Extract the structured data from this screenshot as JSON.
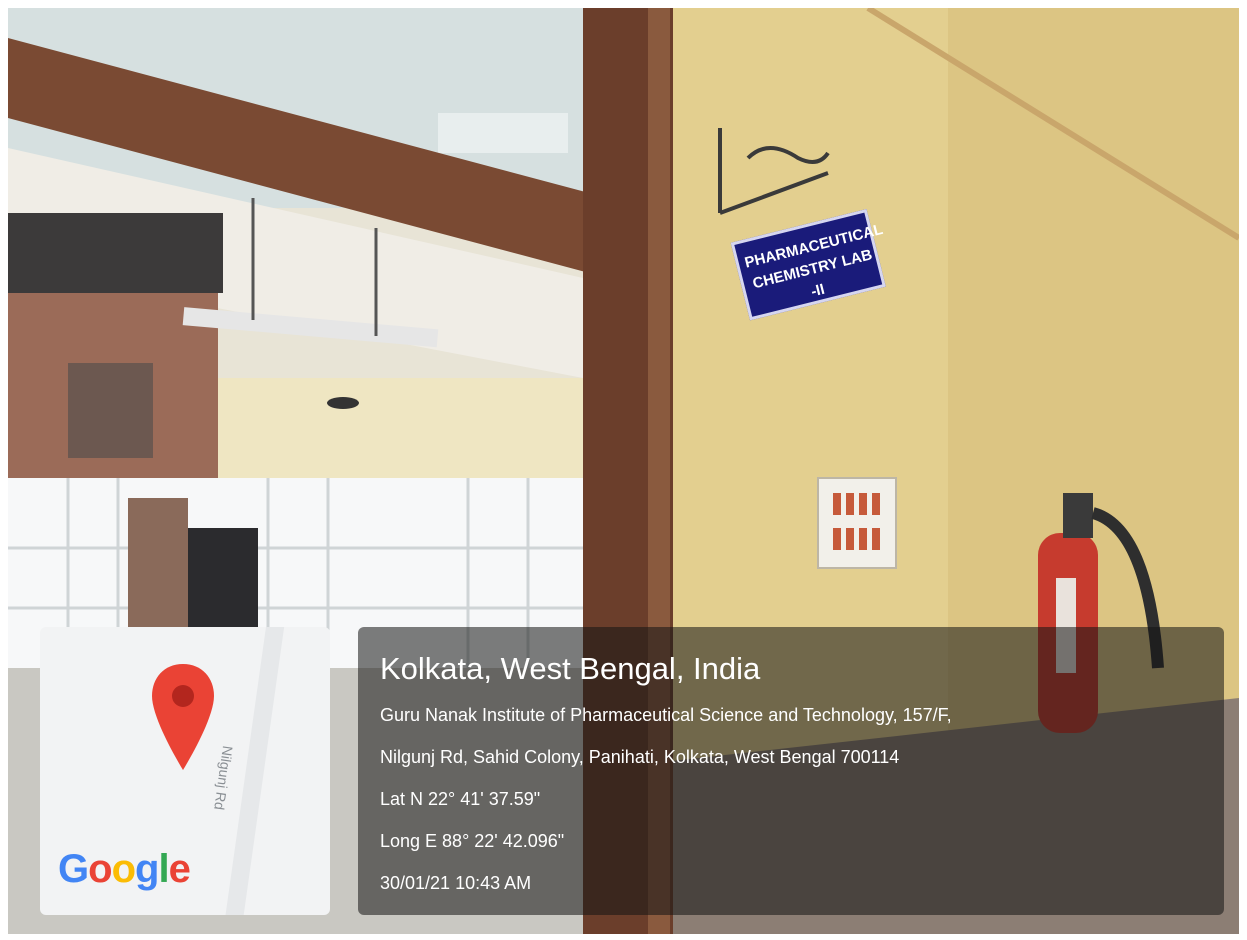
{
  "photo": {
    "sign_text_line1": "PHARMACEUTICAL",
    "sign_text_line2": "CHEMISTRY LAB -II"
  },
  "map_card": {
    "road_label": "Nilgunj Rd",
    "logo_text": "Google",
    "pin_icon": "map-pin-icon",
    "colors": {
      "pin": "#ea4335",
      "logo_blue": "#4285f4",
      "logo_red": "#ea4335",
      "logo_yellow": "#fbbc05",
      "logo_green": "#34a853"
    }
  },
  "geotag": {
    "title": "Kolkata, West Bengal, India",
    "address_line1": "Guru Nanak Institute of Pharmaceutical Science and Technology, 157/F,",
    "address_line2": "Nilgunj Rd, Sahid Colony, Panihati, Kolkata, West Bengal 700114",
    "latitude": "Lat N 22° 41' 37.59\"",
    "longitude": "Long E 88° 22' 42.096\"",
    "timestamp": "30/01/21 10:43 AM"
  }
}
